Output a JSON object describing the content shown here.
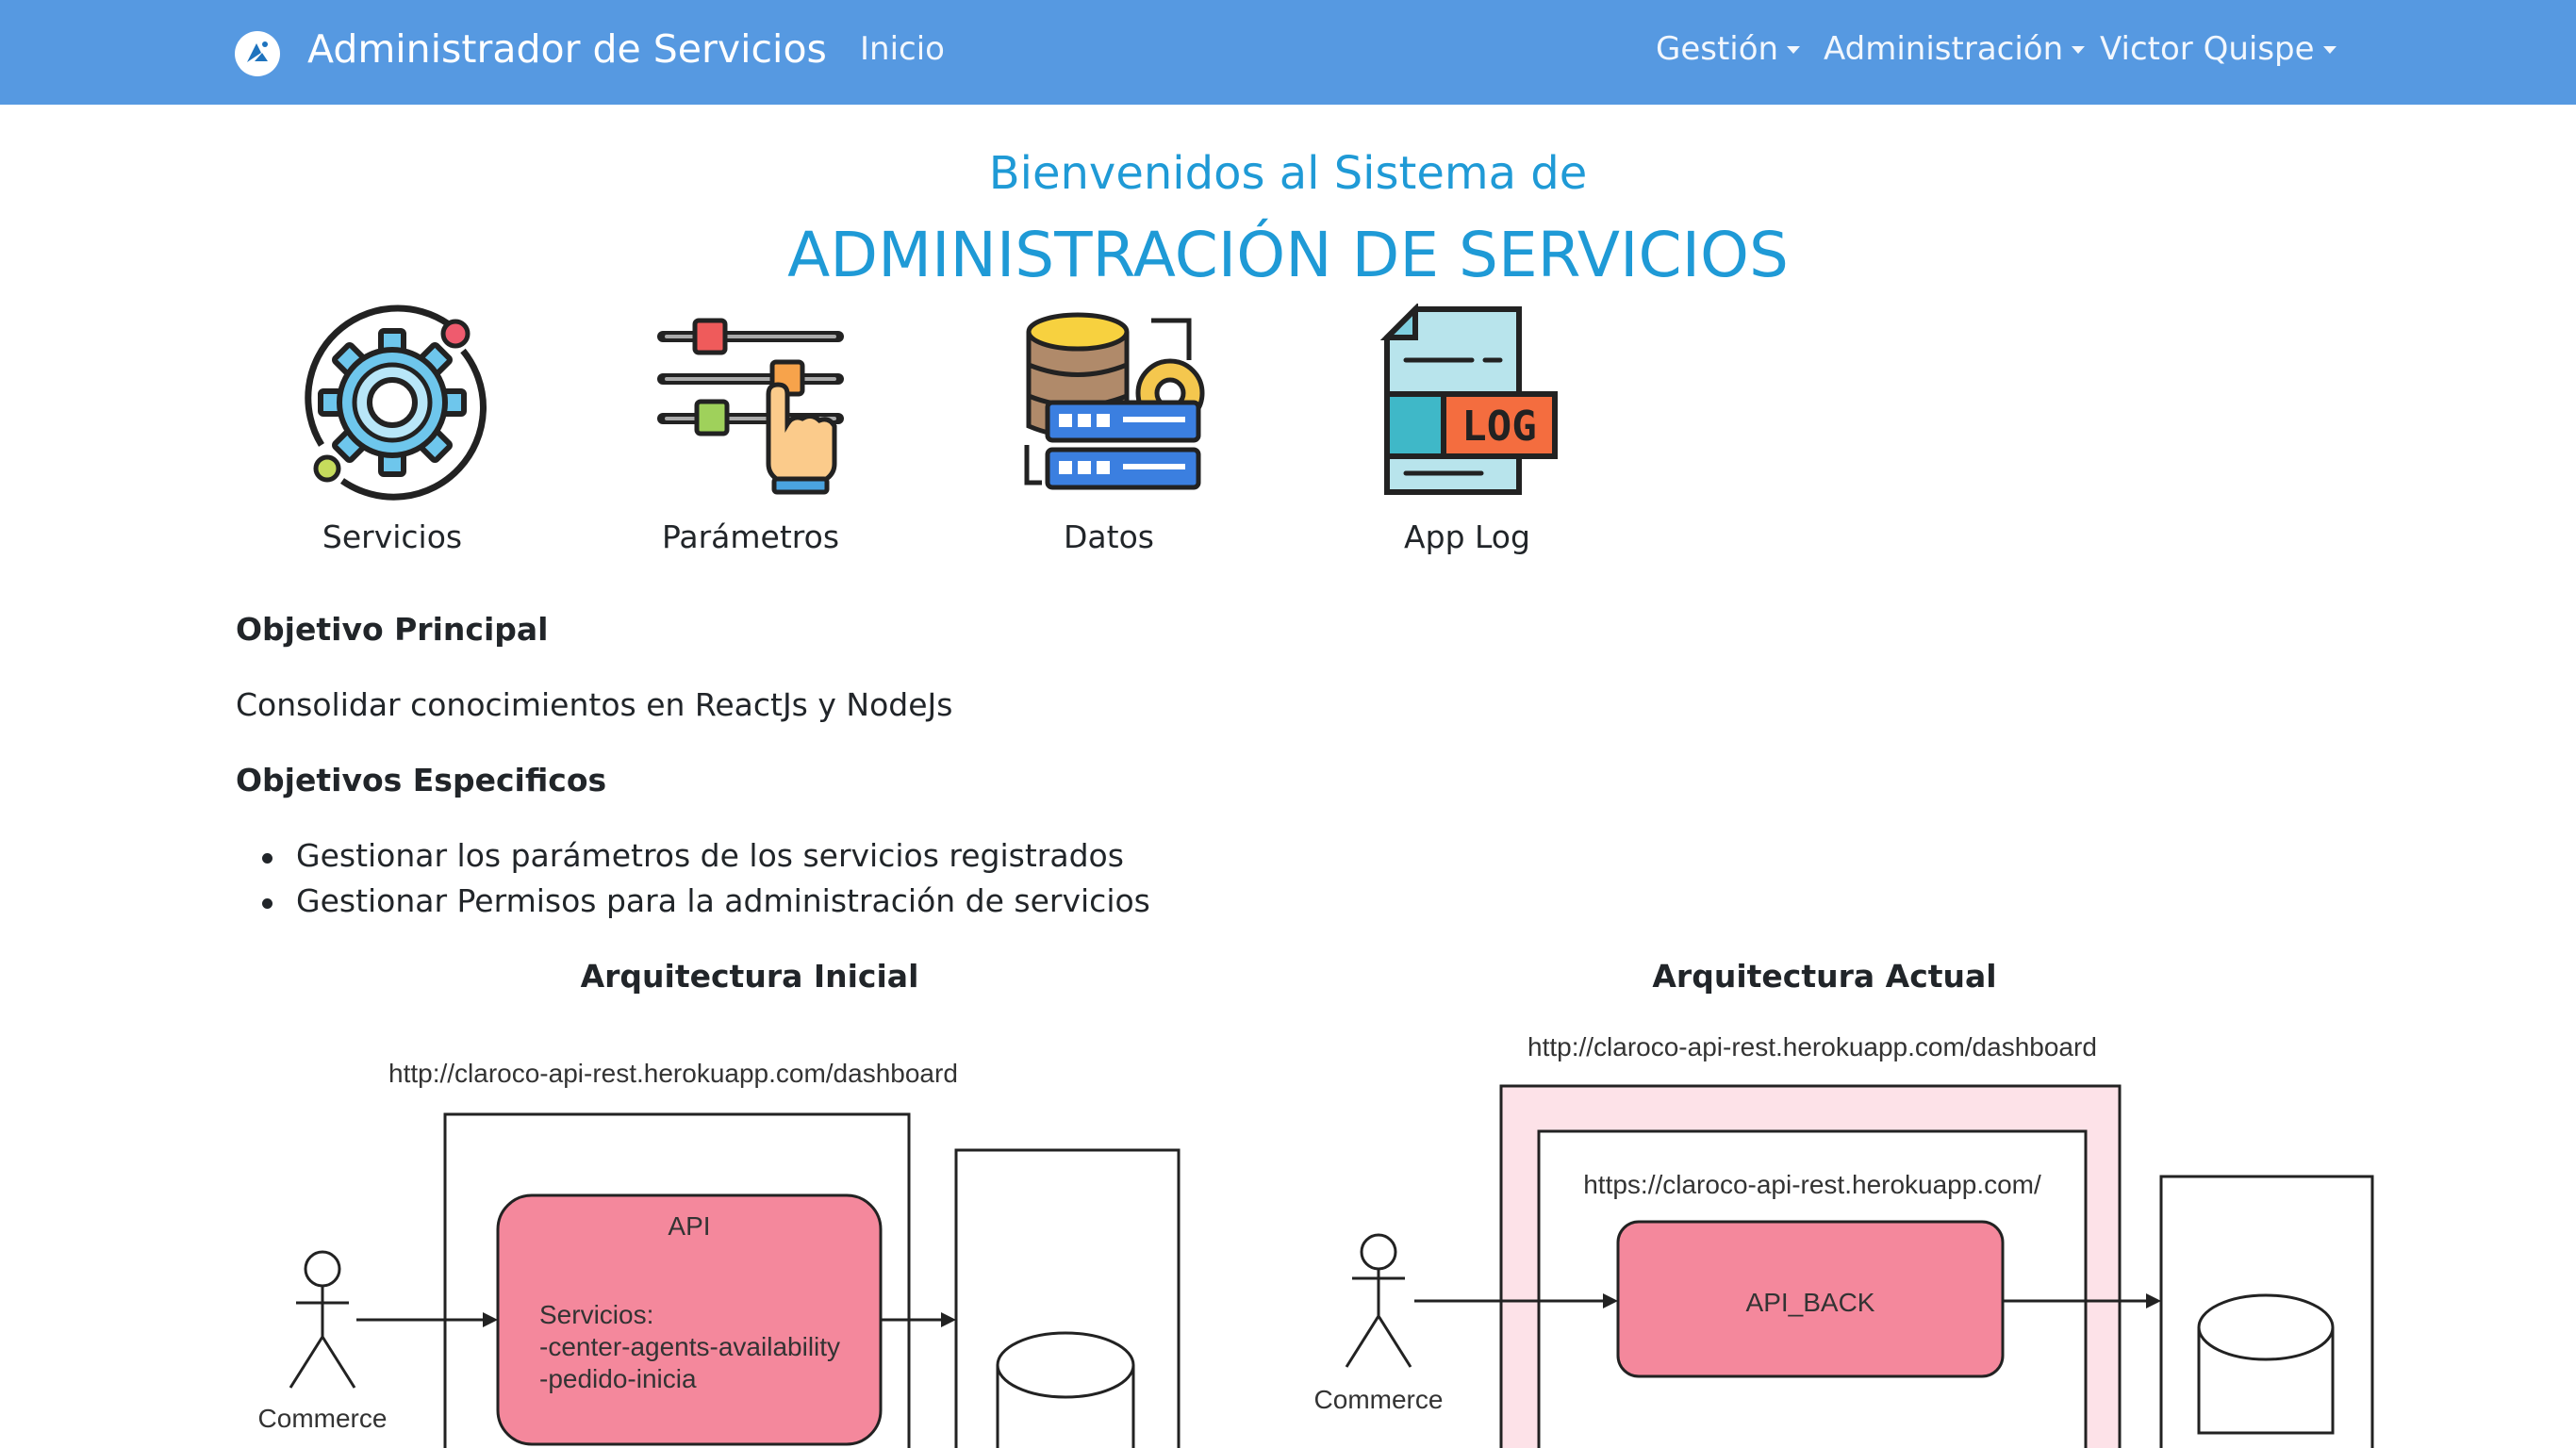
{
  "navbar": {
    "brand": "Administrador de Servicios",
    "links": {
      "inicio": "Inicio",
      "gestion": "Gestión",
      "administracion": "Administración",
      "user": "Victor Quispe"
    },
    "background_color": "#5699e1"
  },
  "welcome": {
    "subtitle": "Bienvenidos al Sistema de",
    "title": "ADMINISTRACIÓN DE SERVICIOS",
    "color": "#1f9ad6"
  },
  "tiles": [
    {
      "label": "Servicios",
      "icon": "gear-orbit-icon"
    },
    {
      "label": "Parámetros",
      "icon": "sliders-hand-icon"
    },
    {
      "label": "Datos",
      "icon": "database-server-icon"
    },
    {
      "label": "App Log",
      "icon": "log-file-icon"
    }
  ],
  "content": {
    "objective_heading": "Objetivo Principal",
    "objective_text": "Consolidar conocimientos en ReactJs y NodeJs",
    "specific_heading": "Objetivos Especificos",
    "specific_items": [
      "Gestionar los parámetros de los servicios registrados",
      "Gestionar Permisos para la administración de servicios"
    ]
  },
  "architecture": {
    "initial": {
      "title": "Arquitectura Inicial",
      "url": "http://claroco-api-rest.herokuapp.com/dashboard",
      "api_label": "API",
      "services_lines": [
        "Servicios:",
        "-center-agents-availability",
        "-pedido-inicia"
      ],
      "actor": "Commerce"
    },
    "current": {
      "title": "Arquitectura Actual",
      "url": "http://claroco-api-rest.herokuapp.com/dashboard",
      "inner_url": "https://claroco-api-rest.herokuapp.com/",
      "api_label": "API_BACK",
      "actor": "Commerce"
    }
  }
}
